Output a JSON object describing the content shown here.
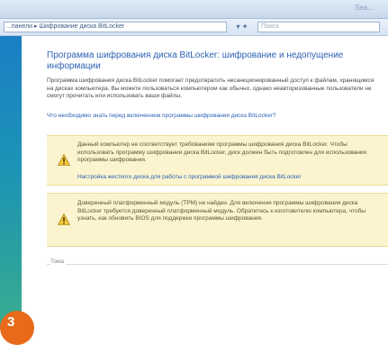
{
  "window": {
    "title": "Sea..."
  },
  "address": {
    "breadcrumb": "...панели ▸ Шифрование диска BitLocker",
    "nav_symbols": "▾ ✦",
    "search_placeholder": "Поиск"
  },
  "page": {
    "title": "Программа шифрования диска BitLocker: шифрование и недопущение информации",
    "description": "Программа шифрования диска BitLocker помогает предотвратить несанкционированный доступ к файлам, хранящимся на дисках компьютера. Вы можете пользоваться компьютером как обычно, однако неавторизованные пользователи не смогут прочитать или использовать ваши файлы.",
    "help_link": "Что необходимо знать перед включением программы шифрования диска BitLocker?"
  },
  "warnings": [
    {
      "icon": "warning-icon",
      "text": "Данный компьютер не соответствует требованиям программы шифрования диска BitLocker. Чтобы использовать программу шифрования диска BitLocker, диск должен быть подготовлен для использования программы шифрования.",
      "link": "Настройка жесткого диска для работы с программой шифрования диска BitLocker"
    },
    {
      "icon": "warning-icon",
      "text": "Доверенный платформенный модуль (TPM) не найден. Для включения программы шифрования диска BitLocker требуется доверенный платформенный модуль. Обратитесь к изготовителю компьютера, чтобы узнать, как обновить BIOS для поддержки программы шифрования."
    }
  ],
  "footer": {
    "label": "Тома"
  },
  "badge": {
    "number": "3"
  },
  "colors": {
    "accent": "#2d62b3",
    "warning_bg": "#fbf4cf",
    "badge": "#e86a1a"
  }
}
